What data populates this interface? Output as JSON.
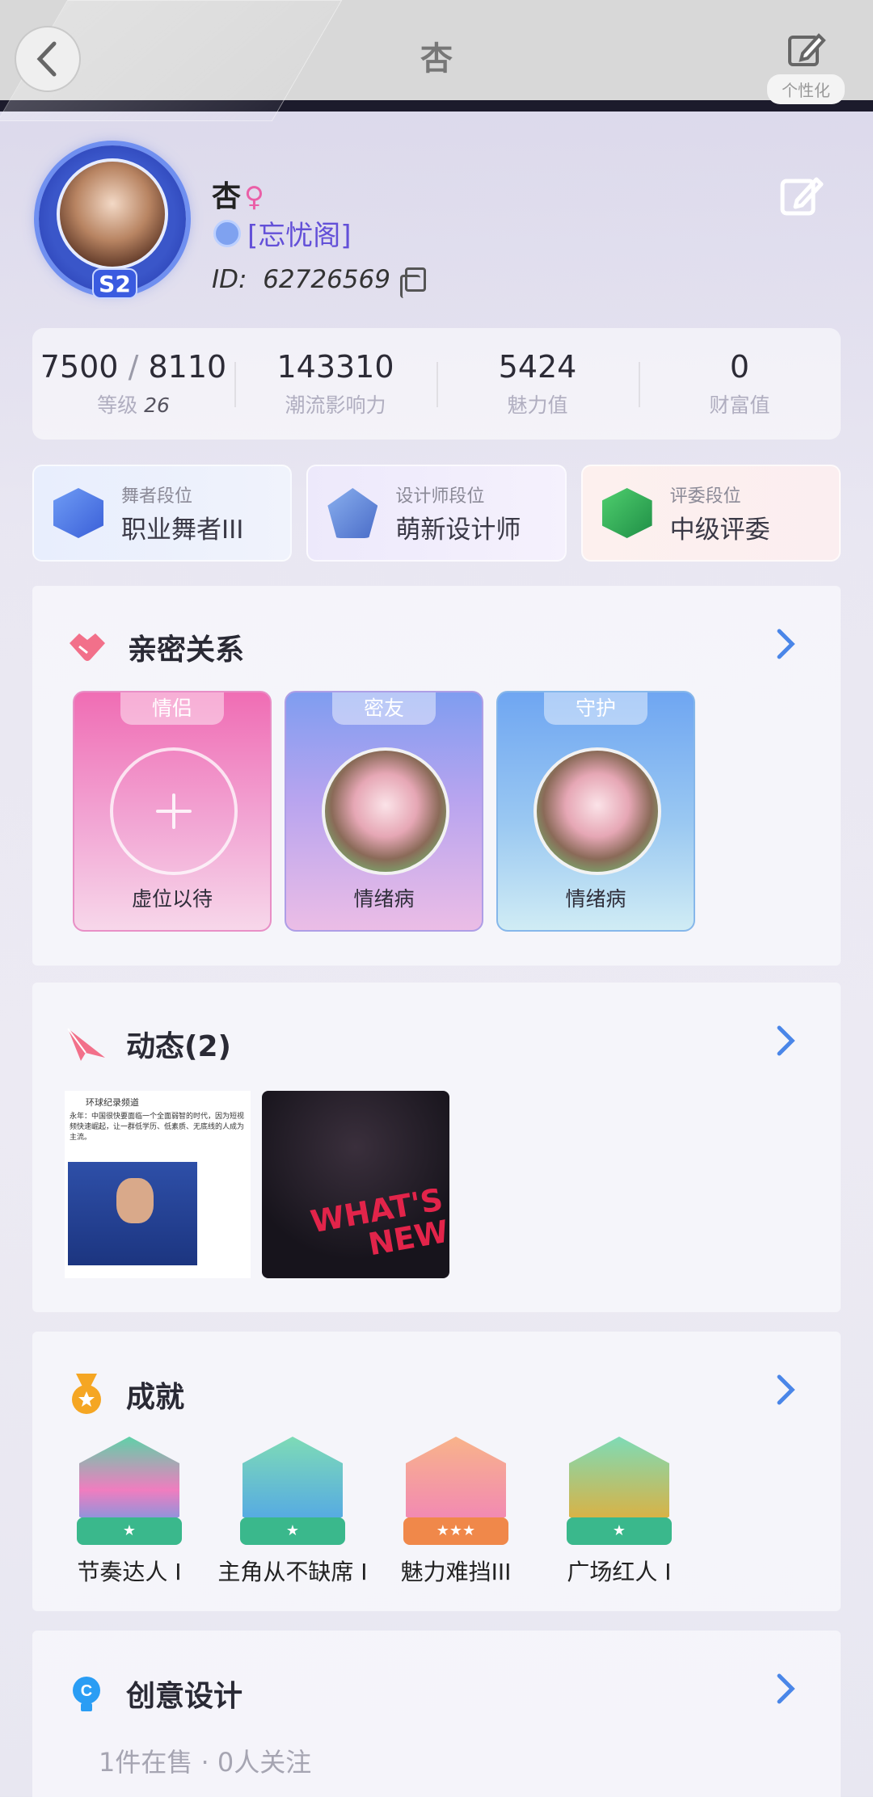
{
  "topbar": {
    "title": "杏",
    "personalize_label": "个性化"
  },
  "profile": {
    "name": "杏",
    "gender_symbol": "♀",
    "guild": "[忘忧阁]",
    "id_label": "ID:",
    "id_value": "62726569",
    "season_badge": "S2"
  },
  "stats": [
    {
      "value_a": "7500",
      "sep": "/",
      "value_b": "8110",
      "label": "等级",
      "level": "26"
    },
    {
      "value": "143310",
      "label": "潮流影响力"
    },
    {
      "value": "5424",
      "label": "魅力值"
    },
    {
      "value": "0",
      "label": "财富值"
    }
  ],
  "ranks": [
    {
      "title": "舞者段位",
      "value": "职业舞者III",
      "icon": "dancer-rank-icon",
      "color": "#4f7ee8"
    },
    {
      "title": "设计师段位",
      "value": "萌新设计师",
      "icon": "designer-rank-icon",
      "color": "#5d82d8"
    },
    {
      "title": "评委段位",
      "value": "中级评委",
      "icon": "judge-rank-icon",
      "color": "#2fa85c"
    }
  ],
  "intimate": {
    "title": "亲密关系",
    "items": [
      {
        "tag": "情侣",
        "name": "虚位以待"
      },
      {
        "tag": "密友",
        "name": "情绪病"
      },
      {
        "tag": "守护",
        "name": "情绪病"
      }
    ]
  },
  "moments": {
    "title": "动态(2)",
    "thumb1_channel": "环球纪录频道",
    "thumb1_text": "永年：中国很快要面临一个全面弱智的时代，因为短视频快速崛起，让一群低学历、低素质、无底线的人成为主流。",
    "thumb2_text_a": "WHAT'S",
    "thumb2_text_b": "NEW"
  },
  "achievements": {
    "title": "成就",
    "items": [
      {
        "label": "节奏达人 I",
        "icon": "rhythm-master-icon",
        "color": "#3aa7f5",
        "stars": "★"
      },
      {
        "label": "主角从不缺席 I",
        "icon": "protagonist-icon",
        "color": "#4a9cf0",
        "stars": "★"
      },
      {
        "label": "魅力难挡III",
        "icon": "charm-icon",
        "color": "#f07dbf",
        "stars": "★★★"
      },
      {
        "label": "广场红人 I",
        "icon": "square-star-icon",
        "color": "#f5a623",
        "stars": "★"
      }
    ]
  },
  "creative": {
    "title": "创意设计",
    "subtitle": "1件在售 · 0人关注"
  }
}
